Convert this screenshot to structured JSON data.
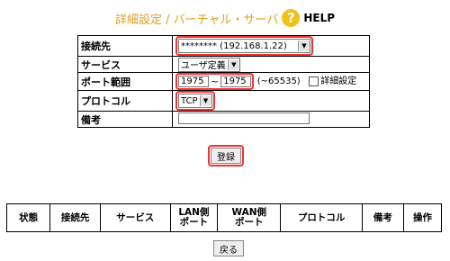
{
  "page": {
    "title": "詳細設定 / バーチャル・サーバ",
    "help_label": "HELP",
    "help_glyph": "?"
  },
  "form": {
    "rows": {
      "destination": {
        "label": "接続先",
        "value": "******** (192.168.1.22)"
      },
      "service": {
        "label": "サービス",
        "value": "ユーザ定義"
      },
      "port_range": {
        "label": "ポート範囲",
        "from": "1975",
        "separator": "~",
        "to": "1975",
        "max_hint": "(~65535)",
        "detail_label": "詳細設定"
      },
      "protocol": {
        "label": "プロトコル",
        "value": "TCP"
      },
      "note": {
        "label": "備考",
        "value": ""
      }
    },
    "register_label": "登録"
  },
  "list": {
    "columns": [
      "状態",
      "接続先",
      "サービス",
      "LAN側\nポート",
      "WAN側\nポート",
      "プロトコル",
      "備考",
      "操作"
    ]
  },
  "back_label": "戻る",
  "colors": {
    "title": "#e0a020",
    "highlight": "#e33333",
    "help_icon": "#f1c21b"
  }
}
